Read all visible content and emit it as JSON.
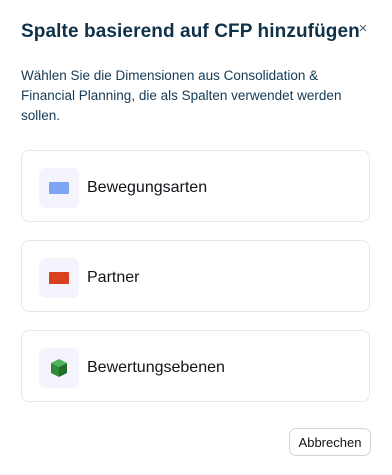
{
  "dialog": {
    "title": "Spalte basierend auf CFP hinzufügen",
    "close_label": "×",
    "description": "Wählen Sie die Dimensionen aus Consolidation & Financial Planning, die als Spalten verwendet werden sollen."
  },
  "options": [
    {
      "label": "Bewegungsarten",
      "icon": "blue-rectangle-icon",
      "icon_color": "#7ea6f2"
    },
    {
      "label": "Partner",
      "icon": "red-rectangle-icon",
      "icon_color": "#d9401e"
    },
    {
      "label": "Bewertungsebenen",
      "icon": "green-cube-icon",
      "icon_color": "#2e8b3a"
    }
  ],
  "footer": {
    "cancel_label": "Abbrechen"
  }
}
